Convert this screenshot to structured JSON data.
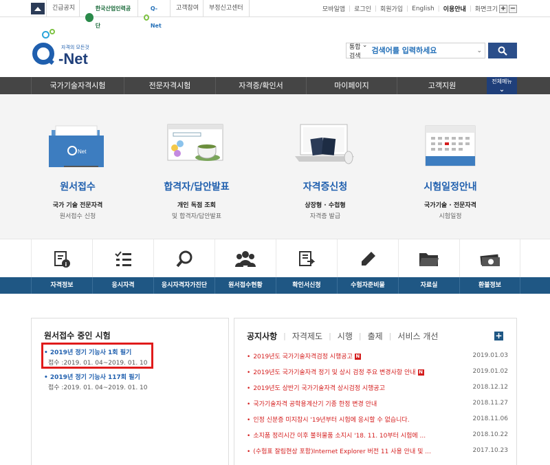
{
  "topbar": {
    "notice_label": "긴급공지",
    "hrdk_label": "한국산업인력공단",
    "qnet_label": "Q-Net",
    "participation_label": "고객참여",
    "report_label": "부정신고센터",
    "links": [
      "모바일앱",
      "로그인",
      "회원가입",
      "English",
      "이용안내",
      "화면크기"
    ],
    "zoom_in": "+",
    "zoom_out": "−"
  },
  "header": {
    "logo_tagline": "자격의 모든것",
    "logo_text": "Net",
    "search_category": "통합검색",
    "search_placeholder": "검색어를 입력하세요"
  },
  "nav": {
    "items": [
      "국가기술자격시험",
      "전문자격시험",
      "자격증/확인서",
      "마이페이지",
      "고객지원"
    ],
    "allmenu": "전체메뉴"
  },
  "hero": [
    {
      "title": "원서접수",
      "sub": "국가 기술 전문자격",
      "sub2": "원서접수 신청"
    },
    {
      "title": "합격자/답안발표",
      "sub": "개인 독점 조회",
      "sub2": "및 합격자/답안발표"
    },
    {
      "title": "자격증신청",
      "sub": "상장형 · 수첩형",
      "sub2": "자격증 발급"
    },
    {
      "title": "시험일정안내",
      "sub": "국가기술 · 전문자격",
      "sub2": "시험일정"
    }
  ],
  "quickmenu": {
    "labels": [
      "자격정보",
      "응시자격",
      "응시자격자가진단",
      "원서접수현황",
      "확인서신청",
      "수험자준비물",
      "자료실",
      "환불정보"
    ],
    "icons": [
      "document-info-icon",
      "checklist-icon",
      "magnifier-icon",
      "people-icon",
      "certificate-icon",
      "pencil-icon",
      "folder-icon",
      "money-icon"
    ]
  },
  "exams": {
    "title": "원서접수 중인 시험",
    "items": [
      {
        "name": "2019년 정기 기능사 1회 필기",
        "period": "접수 :2019. 01. 04~2019. 01. 10"
      },
      {
        "name": "2019년 정기 기능사 117회 필기",
        "period": "접수 :2019. 01. 04~2019. 01. 10"
      }
    ]
  },
  "notices": {
    "tabs": [
      "공지사항",
      "자격제도",
      "시행",
      "출제",
      "서비스 개선"
    ],
    "more": "+",
    "items": [
      {
        "text": "2019년도 국가기술자격검정 시행공고",
        "new": "N",
        "date": "2019.01.03"
      },
      {
        "text": "2019년도 국가기술자격 정기 및 상시 검정 주요 변경사항 안내",
        "new": "N",
        "date": "2019.01.02"
      },
      {
        "text": "2019년도 상반기 국가기술자격 상시검정 시행공고",
        "new": "",
        "date": "2018.12.12"
      },
      {
        "text": "국가기술자격 공학용계산기 기종 한정 변경 안내",
        "new": "",
        "date": "2018.11.27"
      },
      {
        "text": "인정 신분증 미지참시 '19년부터 시험에 응시할 수 없습니다.",
        "new": "",
        "date": "2018.11.06"
      },
      {
        "text": "소지품 정리시간 이후 불허물품 소지시 '18. 11. 10부터 시험에 ...",
        "new": "",
        "date": "2018.10.22"
      },
      {
        "text": "(수험표 잘림현상 포함)Internet Explorer 버전 11 사용 안내 및 ...",
        "new": "",
        "date": "2017.10.23"
      }
    ]
  },
  "colors": {
    "brand_blue": "#1f5fae",
    "nav_gray": "#454545",
    "quickmenu_bar": "#1f5784",
    "notice_red": "#d41c1c",
    "highlight_box": "#e01b1b"
  }
}
